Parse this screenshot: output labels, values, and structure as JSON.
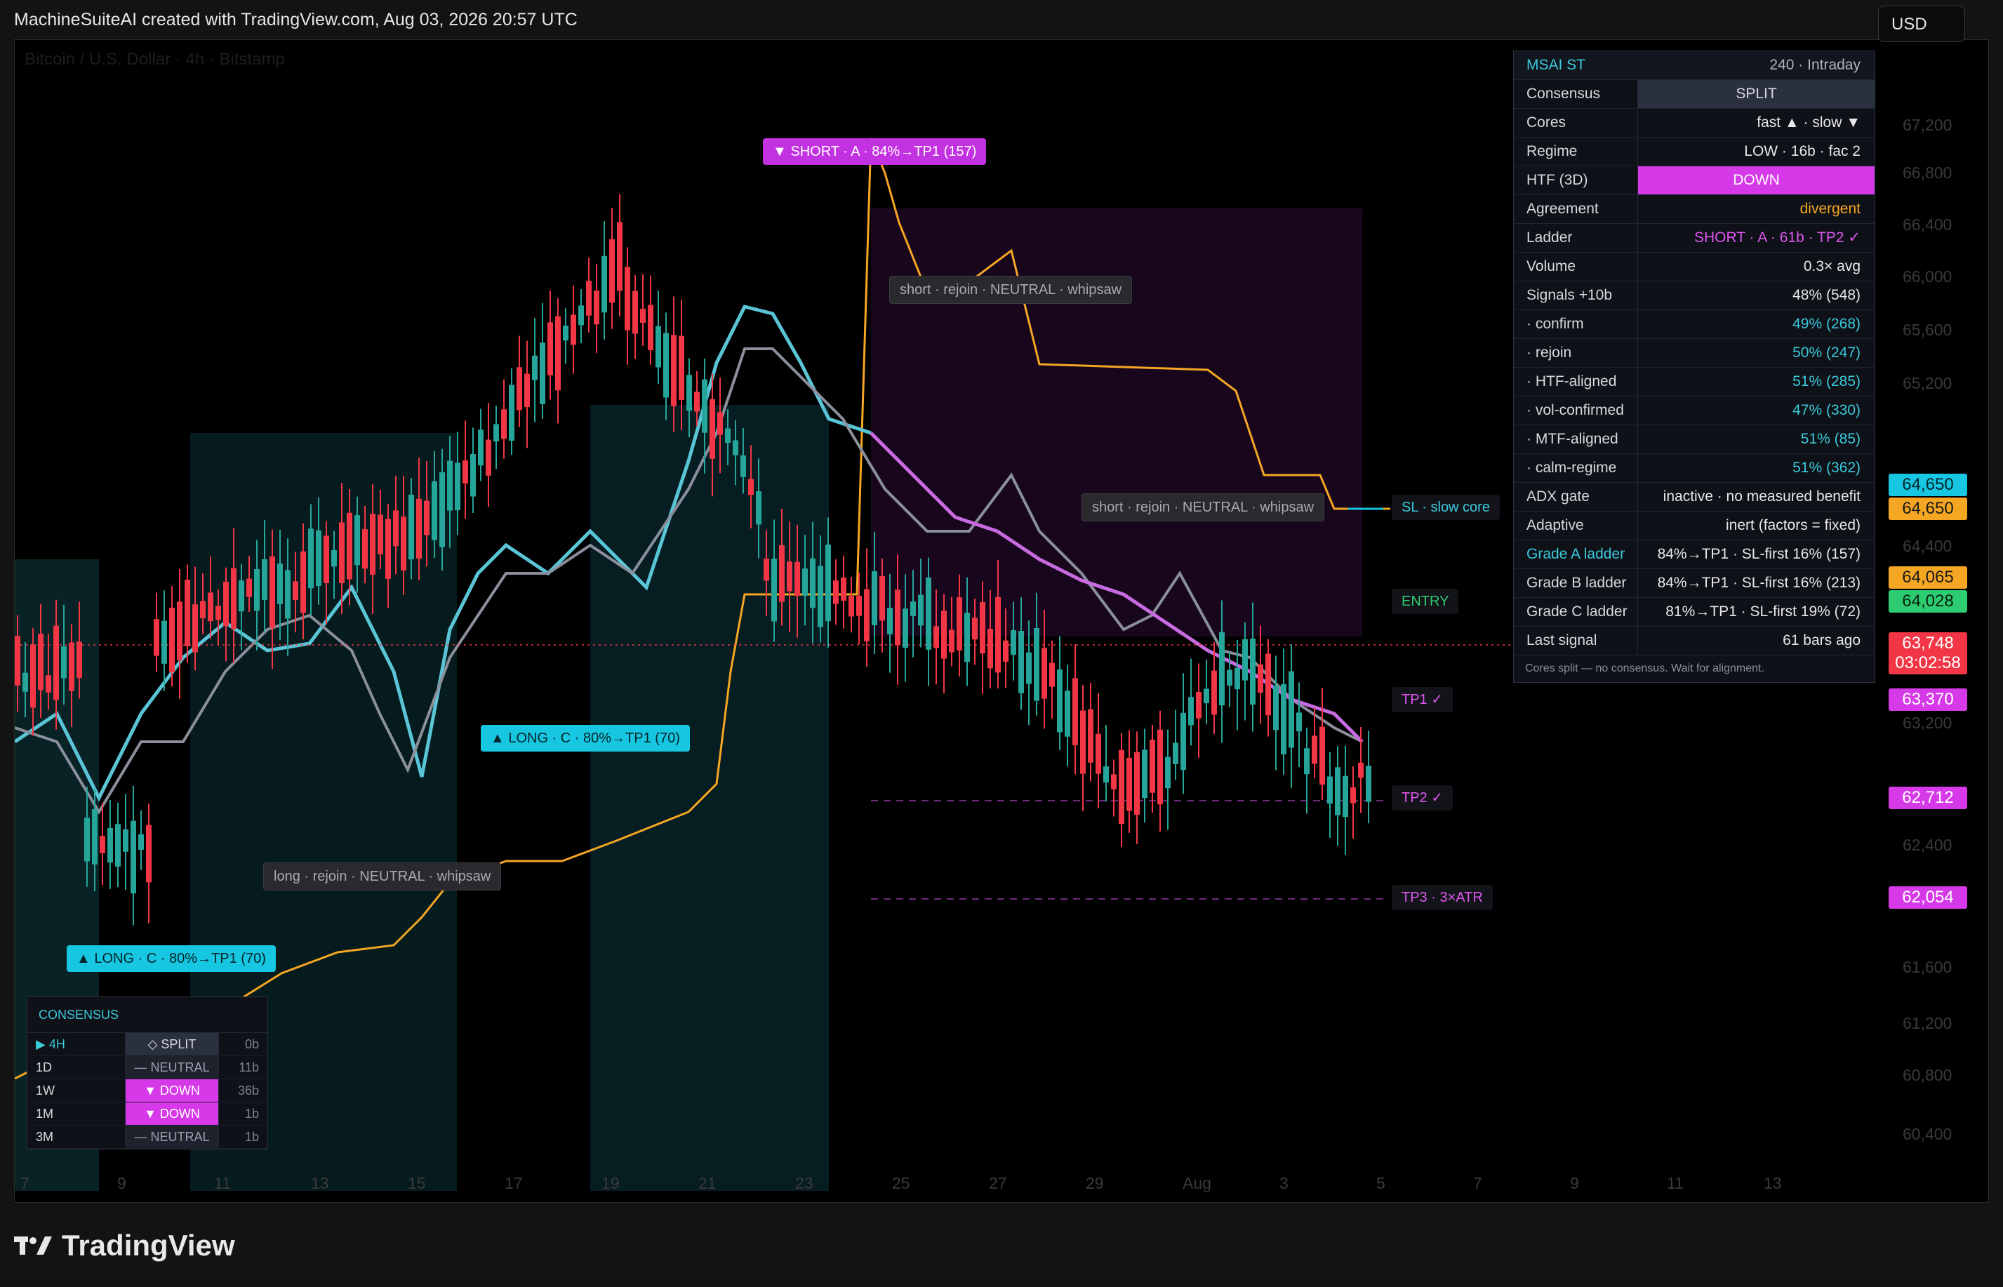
{
  "header": {
    "caption": "MachineSuiteAI created with TradingView.com, Aug 03, 2026 20:57 UTC"
  },
  "watermark": "Bitcoin / U.S. Dollar · 4h · Bitstamp",
  "currency_button": "USD",
  "price_axis": [
    "67,200",
    "66,800",
    "66,400",
    "66,000",
    "65,600",
    "65,200",
    "64,400",
    "63,200",
    "62,400",
    "61,600",
    "61,200",
    "60,800",
    "60,400"
  ],
  "time_axis": [
    "7",
    "9",
    "11",
    "13",
    "15",
    "17",
    "19",
    "21",
    "23",
    "25",
    "27",
    "29",
    "Aug",
    "3",
    "5",
    "7",
    "9",
    "11",
    "13"
  ],
  "price_labels": {
    "p1": "64,650",
    "p2": "64,650",
    "p3": "64,065",
    "p4": "64,028",
    "last_price": "63,748",
    "countdown": "03:02:58",
    "tp1": "63,370",
    "tp2": "62,712",
    "tp3": "62,054"
  },
  "chart_tags": {
    "short_a": "▼ SHORT · A · 84%→TP1 (157)",
    "short_rejoin_1": "short · rejoin · NEUTRAL · whipsaw",
    "short_rejoin_2": "short · rejoin · NEUTRAL · whipsaw",
    "long_c_1": "▲ LONG · C · 80%→TP1 (70)",
    "long_c_2": "▲ LONG · C · 80%→TP1 (70)",
    "long_rejoin": "long · rejoin · NEUTRAL · whipsaw"
  },
  "right_tags": {
    "sl": "SL · slow core",
    "entry": "ENTRY",
    "tp1": "TP1 ✓",
    "tp2": "TP2 ✓",
    "tp3": "TP3 · 3×ATR"
  },
  "info_table": {
    "title": "MSAI ST",
    "timeframe": "240 · Intraday",
    "rows": [
      {
        "k": "Consensus",
        "v": "SPLIT"
      },
      {
        "k": "Cores",
        "v": "fast ▲ · slow ▼"
      },
      {
        "k": "Regime",
        "v": "LOW · 16b · fac 2"
      },
      {
        "k": "HTF (3D)",
        "v": "DOWN"
      },
      {
        "k": "Agreement",
        "v": "divergent"
      },
      {
        "k": "Ladder",
        "v": "SHORT · A · 61b · TP2 ✓"
      },
      {
        "k": "Volume",
        "v": "0.3× avg"
      },
      {
        "k": "Signals +10b",
        "v": "48% (548)"
      },
      {
        "k": "· confirm",
        "v": "49% (268)"
      },
      {
        "k": "· rejoin",
        "v": "50% (247)"
      },
      {
        "k": "· HTF-aligned",
        "v": "51% (285)"
      },
      {
        "k": "· vol-confirmed",
        "v": "47% (330)"
      },
      {
        "k": "· MTF-aligned",
        "v": "51% (85)"
      },
      {
        "k": "· calm-regime",
        "v": "51% (362)"
      },
      {
        "k": "ADX gate",
        "v": "inactive · no measured benefit"
      },
      {
        "k": "Adaptive",
        "v": "inert (factors = fixed)"
      },
      {
        "k": "Grade A ladder",
        "v": "84%→TP1 · SL-first 16% (157)"
      },
      {
        "k": "Grade B ladder",
        "v": "84%→TP1 · SL-first 16% (213)"
      },
      {
        "k": "Grade C ladder",
        "v": "81%→TP1 · SL-first 19% (72)"
      },
      {
        "k": "Last signal",
        "v": "61 bars ago"
      }
    ],
    "note": "Cores split — no consensus. Wait for alignment."
  },
  "consensus": {
    "title": "CONSENSUS",
    "rows": [
      {
        "tf": "▶ 4H",
        "state": "◇ SPLIT",
        "bars": "0b"
      },
      {
        "tf": "1D",
        "state": "— NEUTRAL",
        "bars": "11b"
      },
      {
        "tf": "1W",
        "state": "▼ DOWN",
        "bars": "36b"
      },
      {
        "tf": "1M",
        "state": "▼ DOWN",
        "bars": "1b"
      },
      {
        "tf": "3M",
        "state": "— NEUTRAL",
        "bars": "1b"
      }
    ]
  },
  "footer": {
    "brand": "TradingView"
  },
  "colors": {
    "up": "#26a69a",
    "down": "#f23645",
    "cyan": "#17c6e0",
    "magenta": "#c332e0",
    "orange": "#f5a623",
    "green": "#2ecc71",
    "red": "#f23645"
  }
}
